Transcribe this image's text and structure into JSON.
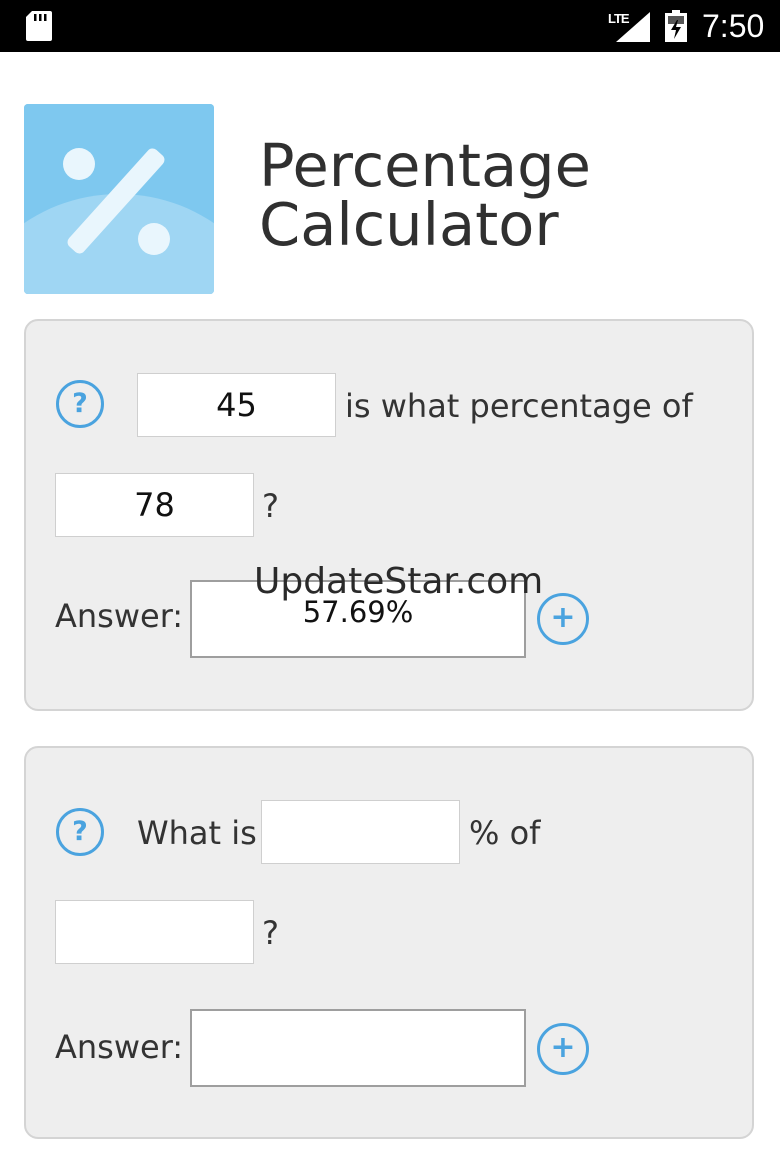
{
  "status_bar": {
    "network": "LTE",
    "time": "7:50"
  },
  "app": {
    "title_line1": "Percentage",
    "title_line2": "Calculator",
    "logo_icon": "percent-icon"
  },
  "card1": {
    "help_label": "?",
    "value1": "45",
    "text1": "is what percentage of",
    "value2": "78",
    "text2": "?",
    "answer_label": "Answer:",
    "answer_value": "57.69%",
    "add_label": "+"
  },
  "card2": {
    "help_label": "?",
    "text_prefix": "What is",
    "value1": "",
    "text1": "% of",
    "value2": "",
    "text2": "?",
    "answer_label": "Answer:",
    "answer_value": "",
    "add_label": "+"
  },
  "watermark": "UpdateStar.com",
  "colors": {
    "accent": "#4aa3df",
    "card_bg": "#eeeeee",
    "logo_bg": "#7ec8ef"
  }
}
